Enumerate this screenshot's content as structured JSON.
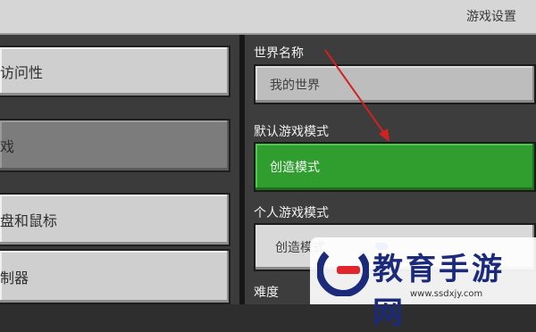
{
  "header": {
    "title": "游戏设置"
  },
  "sidebar": {
    "items": [
      {
        "label": "访问性"
      },
      {
        "label": "戏",
        "selected": true
      },
      {
        "label": "盘和鼠标"
      },
      {
        "label": "制器"
      }
    ]
  },
  "settings": {
    "world_name": {
      "label": "世界名称",
      "value": "我的世界"
    },
    "default_mode": {
      "label": "默认游戏模式",
      "value": "创造模式"
    },
    "personal_mode": {
      "label": "个人游戏模式",
      "value": "创造模式"
    },
    "difficulty": {
      "label": "难度"
    }
  },
  "watermark": {
    "text": "教育手游网",
    "url": "www.ssdxjy.com"
  },
  "colors": {
    "accent_green": "#2f9e2f",
    "annotation_arrow": "#d42020",
    "watermark_blue": "#1b2a7a",
    "watermark_red": "#e0262c"
  },
  "icons": {
    "watermark_logo": "stylized-e-logo-icon",
    "annotation": "red-arrow-icon"
  }
}
